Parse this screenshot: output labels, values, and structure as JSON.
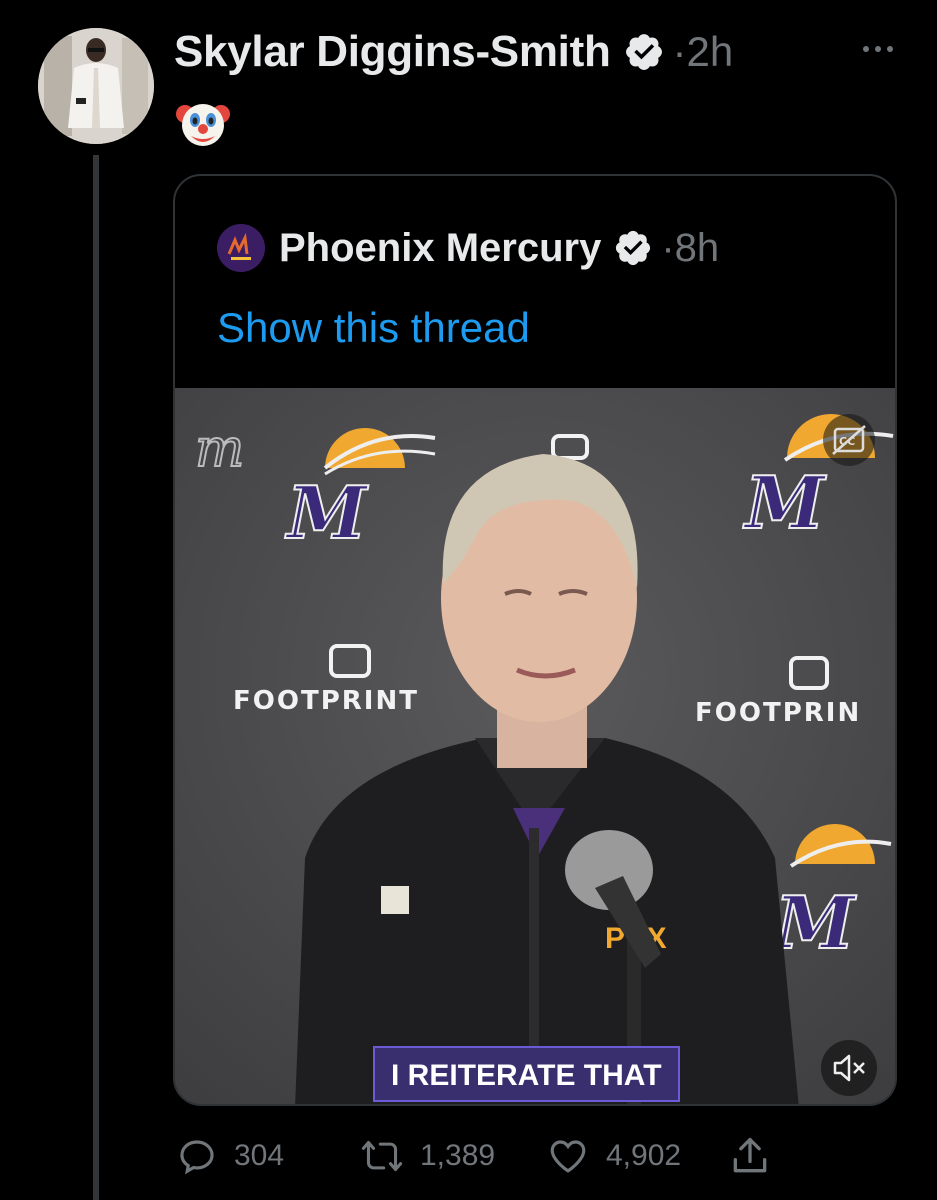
{
  "author": {
    "display_name": "Skylar Diggins-Smith",
    "time": "2h",
    "separator": "·"
  },
  "tweet": {
    "text_emoji": "🤡"
  },
  "quoted": {
    "display_name": "Phoenix Mercury",
    "time": "8h",
    "separator": "·",
    "show_thread": "Show this thread",
    "video": {
      "subtitle": "I REITERATE THAT",
      "backdrop_text": [
        "FOOTPRINT",
        "FOOTPRIN"
      ]
    }
  },
  "actions": {
    "replies": "304",
    "retweets": "1,389",
    "likes": "4,902"
  },
  "icons": {
    "verified": "verified-badge-icon",
    "more": "more-icon",
    "reply": "reply-icon",
    "retweet": "retweet-icon",
    "like": "heart-icon",
    "share": "share-icon",
    "cc": "closed-captions-icon",
    "mute": "mute-icon"
  },
  "colors": {
    "background": "#000000",
    "link": "#1d9bf0",
    "muted_text": "#71767b",
    "subtitle_bg": "#3a2f6e"
  }
}
